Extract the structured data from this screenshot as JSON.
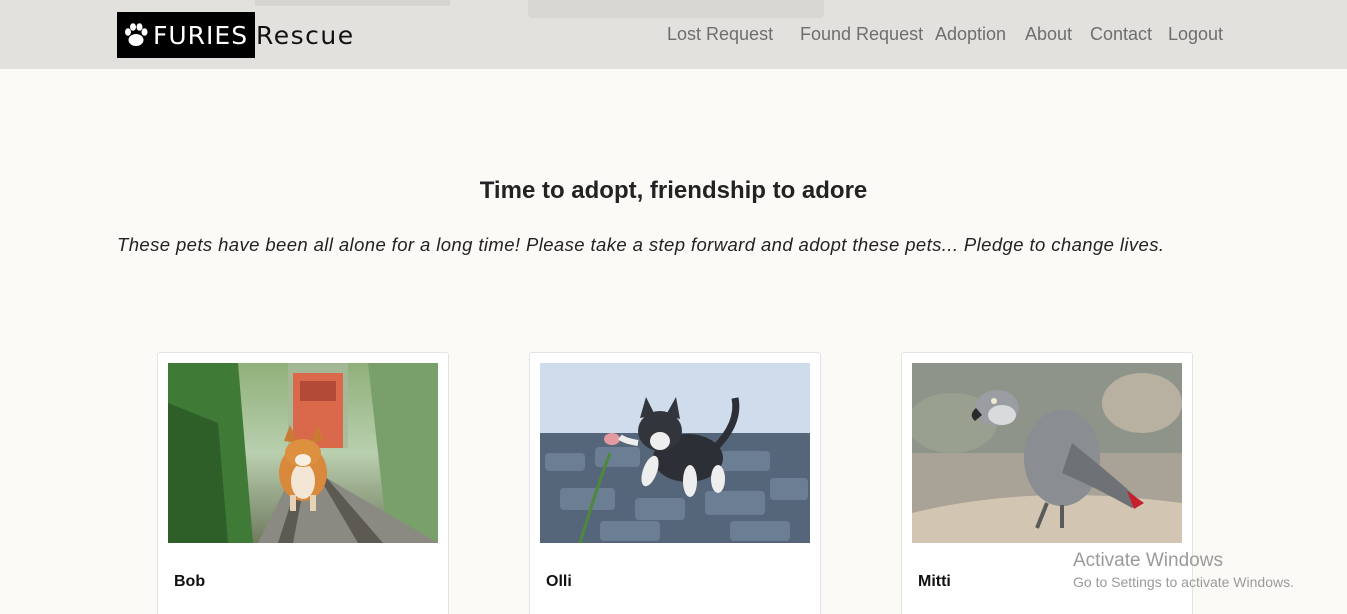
{
  "brand": {
    "strong": "FURIES",
    "rest": "Rescue",
    "icon": "paw-icon"
  },
  "nav": {
    "lost_request": "Lost Request",
    "found_request": "Found Request",
    "adoption": "Adoption",
    "about": "About",
    "contact": "Contact",
    "logout": "Logout"
  },
  "main": {
    "heading": "Time to adopt, friendship to adore",
    "intro": "These pets have been all alone for a long time! Please take a step forward and adopt these pets... Pledge to change lives."
  },
  "pets": [
    {
      "name": "Bob",
      "photo": "corgi-on-railway-photo"
    },
    {
      "name": "Olli",
      "photo": "kitten-with-flower-photo"
    },
    {
      "name": "Mitti",
      "photo": "grey-parrot-photo"
    }
  ],
  "watermark": {
    "title": "Activate Windows",
    "subtitle": "Go to Settings to activate Windows."
  },
  "colors": {
    "navbar": "#e3e1de",
    "background": "#fcfaf6",
    "brand_box": "#000000",
    "nav_text": "#6e6e6e"
  }
}
